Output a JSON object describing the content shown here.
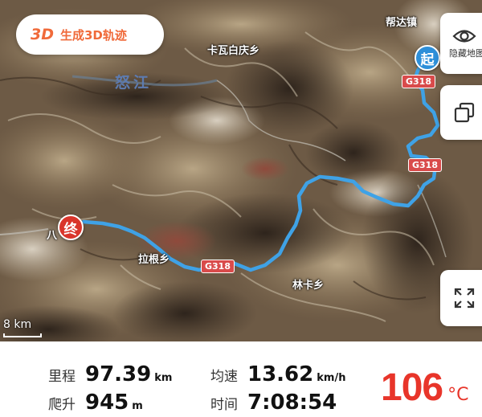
{
  "map": {
    "three_d_button": {
      "tag": "3D",
      "label": "生成3D轨迹"
    },
    "hide_map_label": "隐藏地图",
    "scale": "8 km",
    "place_labels": {
      "bangda": "帮达镇",
      "kawa": "卡瓦白庆乡",
      "lagen": "拉根乡",
      "linka": "林卡乡",
      "ba": "八"
    },
    "river_label": "怒江",
    "road_badges": [
      "G318",
      "G318",
      "G318"
    ],
    "start_marker": "起",
    "end_marker": "终",
    "route_color": "#3fa2e6",
    "icons": [
      "eye-icon",
      "layers-icon",
      "fullscreen-icon"
    ]
  },
  "stats": {
    "distance": {
      "label": "里程",
      "value": "97.39",
      "unit": "km"
    },
    "speed": {
      "label": "均速",
      "value": "13.62",
      "unit": "km/h"
    },
    "climb": {
      "label": "爬升",
      "value": "945",
      "unit": "m"
    },
    "time": {
      "label": "时间",
      "value": "7:08:54"
    },
    "temperature": {
      "value": "106",
      "unit": "°C"
    }
  }
}
